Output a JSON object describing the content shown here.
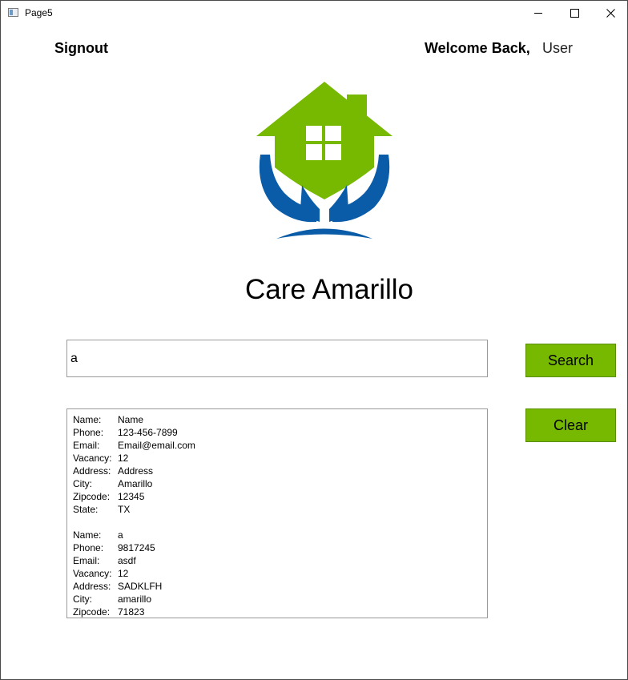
{
  "window": {
    "title": "Page5",
    "minimize": "minimize",
    "maximize": "maximize",
    "close": "close"
  },
  "header": {
    "signout_label": "Signout",
    "welcome_text": "Welcome Back,",
    "username": "User"
  },
  "brand": {
    "title": "Care Amarillo",
    "logo_icon": "house-in-hands-icon",
    "colors": {
      "green": "#77b900",
      "blue": "#0a5ca8"
    }
  },
  "search": {
    "value": "a",
    "button_label": "Search",
    "clear_label": "Clear"
  },
  "results": [
    {
      "fields": [
        {
          "label": "Name:",
          "value": "Name"
        },
        {
          "label": "Phone:",
          "value": "123-456-7899"
        },
        {
          "label": "Email:",
          "value": "Email@email.com"
        },
        {
          "label": "Vacancy:",
          "value": "12"
        },
        {
          "label": "Address:",
          "value": "Address"
        },
        {
          "label": "City:",
          "value": "Amarillo"
        },
        {
          "label": "Zipcode:",
          "value": "12345"
        },
        {
          "label": "State:",
          "value": "TX"
        }
      ]
    },
    {
      "fields": [
        {
          "label": "Name:",
          "value": "a"
        },
        {
          "label": "Phone:",
          "value": "9817245"
        },
        {
          "label": "Email:",
          "value": "asdf"
        },
        {
          "label": "Vacancy:",
          "value": "12"
        },
        {
          "label": "Address:",
          "value": "SADKLFH"
        },
        {
          "label": "City:",
          "value": "amarillo"
        },
        {
          "label": "Zipcode:",
          "value": "71823"
        }
      ]
    }
  ]
}
